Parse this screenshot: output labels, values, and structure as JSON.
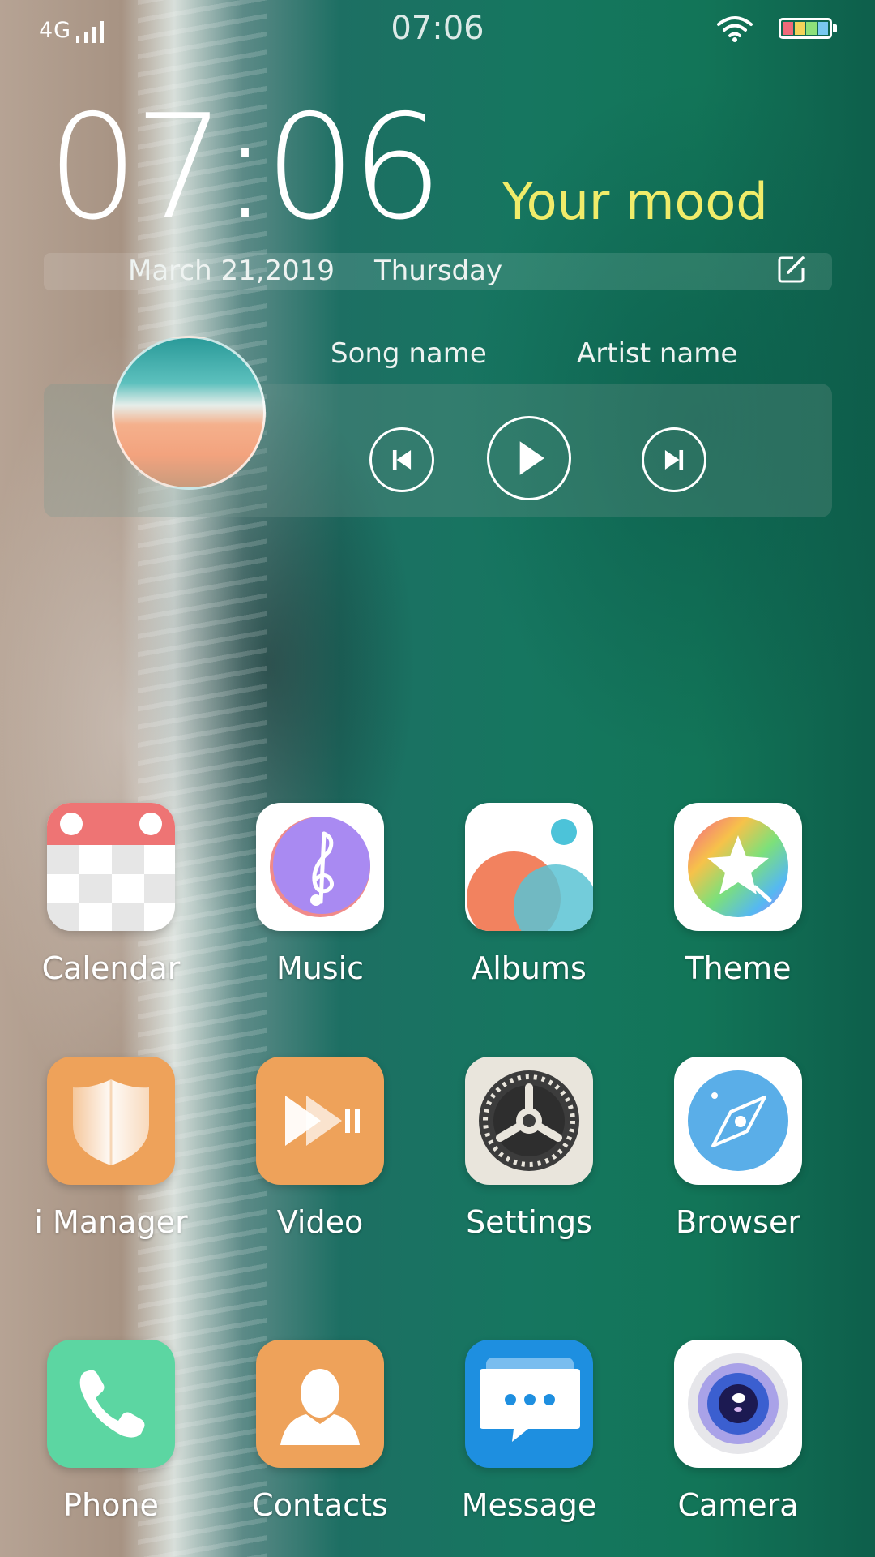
{
  "status_bar": {
    "network": "4G",
    "time": "07:06"
  },
  "clock_widget": {
    "time": "07:06",
    "mood": "Your mood",
    "date": "March 21,2019",
    "weekday": "Thursday"
  },
  "music_widget": {
    "song": "Song name",
    "artist": "Artist name"
  },
  "apps": [
    {
      "label": "Calendar",
      "icon": "calendar-icon"
    },
    {
      "label": "Music",
      "icon": "music-icon"
    },
    {
      "label": "Albums",
      "icon": "albums-icon"
    },
    {
      "label": "Theme",
      "icon": "theme-icon"
    },
    {
      "label": "i Manager",
      "icon": "shield-icon"
    },
    {
      "label": "Video",
      "icon": "video-icon"
    },
    {
      "label": "Settings",
      "icon": "gear-icon"
    },
    {
      "label": "Browser",
      "icon": "compass-icon"
    }
  ],
  "dock": [
    {
      "label": "Phone",
      "icon": "phone-icon"
    },
    {
      "label": "Contacts",
      "icon": "contacts-icon"
    },
    {
      "label": "Message",
      "icon": "message-icon"
    },
    {
      "label": "Camera",
      "icon": "camera-icon"
    }
  ],
  "colors": {
    "mood_text": "#f0ec6a",
    "ocean": "#167660",
    "sand": "#a79383"
  }
}
